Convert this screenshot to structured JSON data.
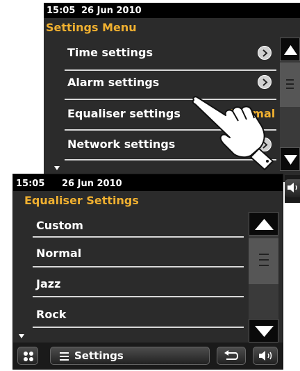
{
  "back_screen": {
    "status": {
      "time": "15:05",
      "date": "26 Jun 2010"
    },
    "title": "Settings Menu",
    "items": [
      {
        "label": "Time settings"
      },
      {
        "label": "Alarm settings"
      },
      {
        "label": "Equaliser settings",
        "value": "Normal"
      },
      {
        "label": "Network settings"
      }
    ]
  },
  "front_screen": {
    "status": {
      "time": "15:05",
      "date": "26 Jun 2010"
    },
    "title": "Equaliser Settings",
    "items": [
      {
        "label": "Custom"
      },
      {
        "label": "Normal"
      },
      {
        "label": "Jazz"
      },
      {
        "label": "Rock"
      }
    ],
    "footer": {
      "menu_label": "Settings"
    }
  },
  "colors": {
    "accent": "#f0b030",
    "background": "#2b2b2b",
    "status_bar": "#000000"
  },
  "icons": [
    "chevron-right-icon",
    "scroll-up-arrow-icon",
    "scroll-down-arrow-icon",
    "grid-icon",
    "list-icon",
    "back-icon",
    "volume-icon",
    "pointing-hand-icon"
  ]
}
